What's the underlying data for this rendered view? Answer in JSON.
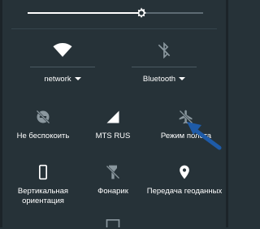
{
  "brightness": {
    "level": 0.65
  },
  "tiles": {
    "wifi": {
      "label": "network",
      "icon": "wifi-icon",
      "has_dropdown": true
    },
    "bluetooth": {
      "label": "Bluetooth",
      "icon": "bluetooth-disabled-icon",
      "has_dropdown": true
    },
    "dnd": {
      "label": "Не беспокоить",
      "icon": "do-not-disturb-off-icon"
    },
    "cellular": {
      "label": "MTS RUS",
      "icon": "cellular-signal-icon"
    },
    "airplane": {
      "label": "Режим полета",
      "icon": "airplane-mode-off-icon"
    },
    "rotation": {
      "label_line1": "Вертикальная",
      "label_line2": "ориентация",
      "icon": "portrait-orientation-icon"
    },
    "flashlight": {
      "label": "Фонарик",
      "icon": "flashlight-off-icon"
    },
    "location": {
      "label": "Передача геоданных",
      "icon": "location-pin-icon"
    },
    "cast": {
      "icon": "cast-screen-icon"
    }
  },
  "colors": {
    "background": "#263238",
    "active": "#ffffff",
    "inactive": "#8a979e",
    "annotation_arrow": "#1e5ba8"
  }
}
